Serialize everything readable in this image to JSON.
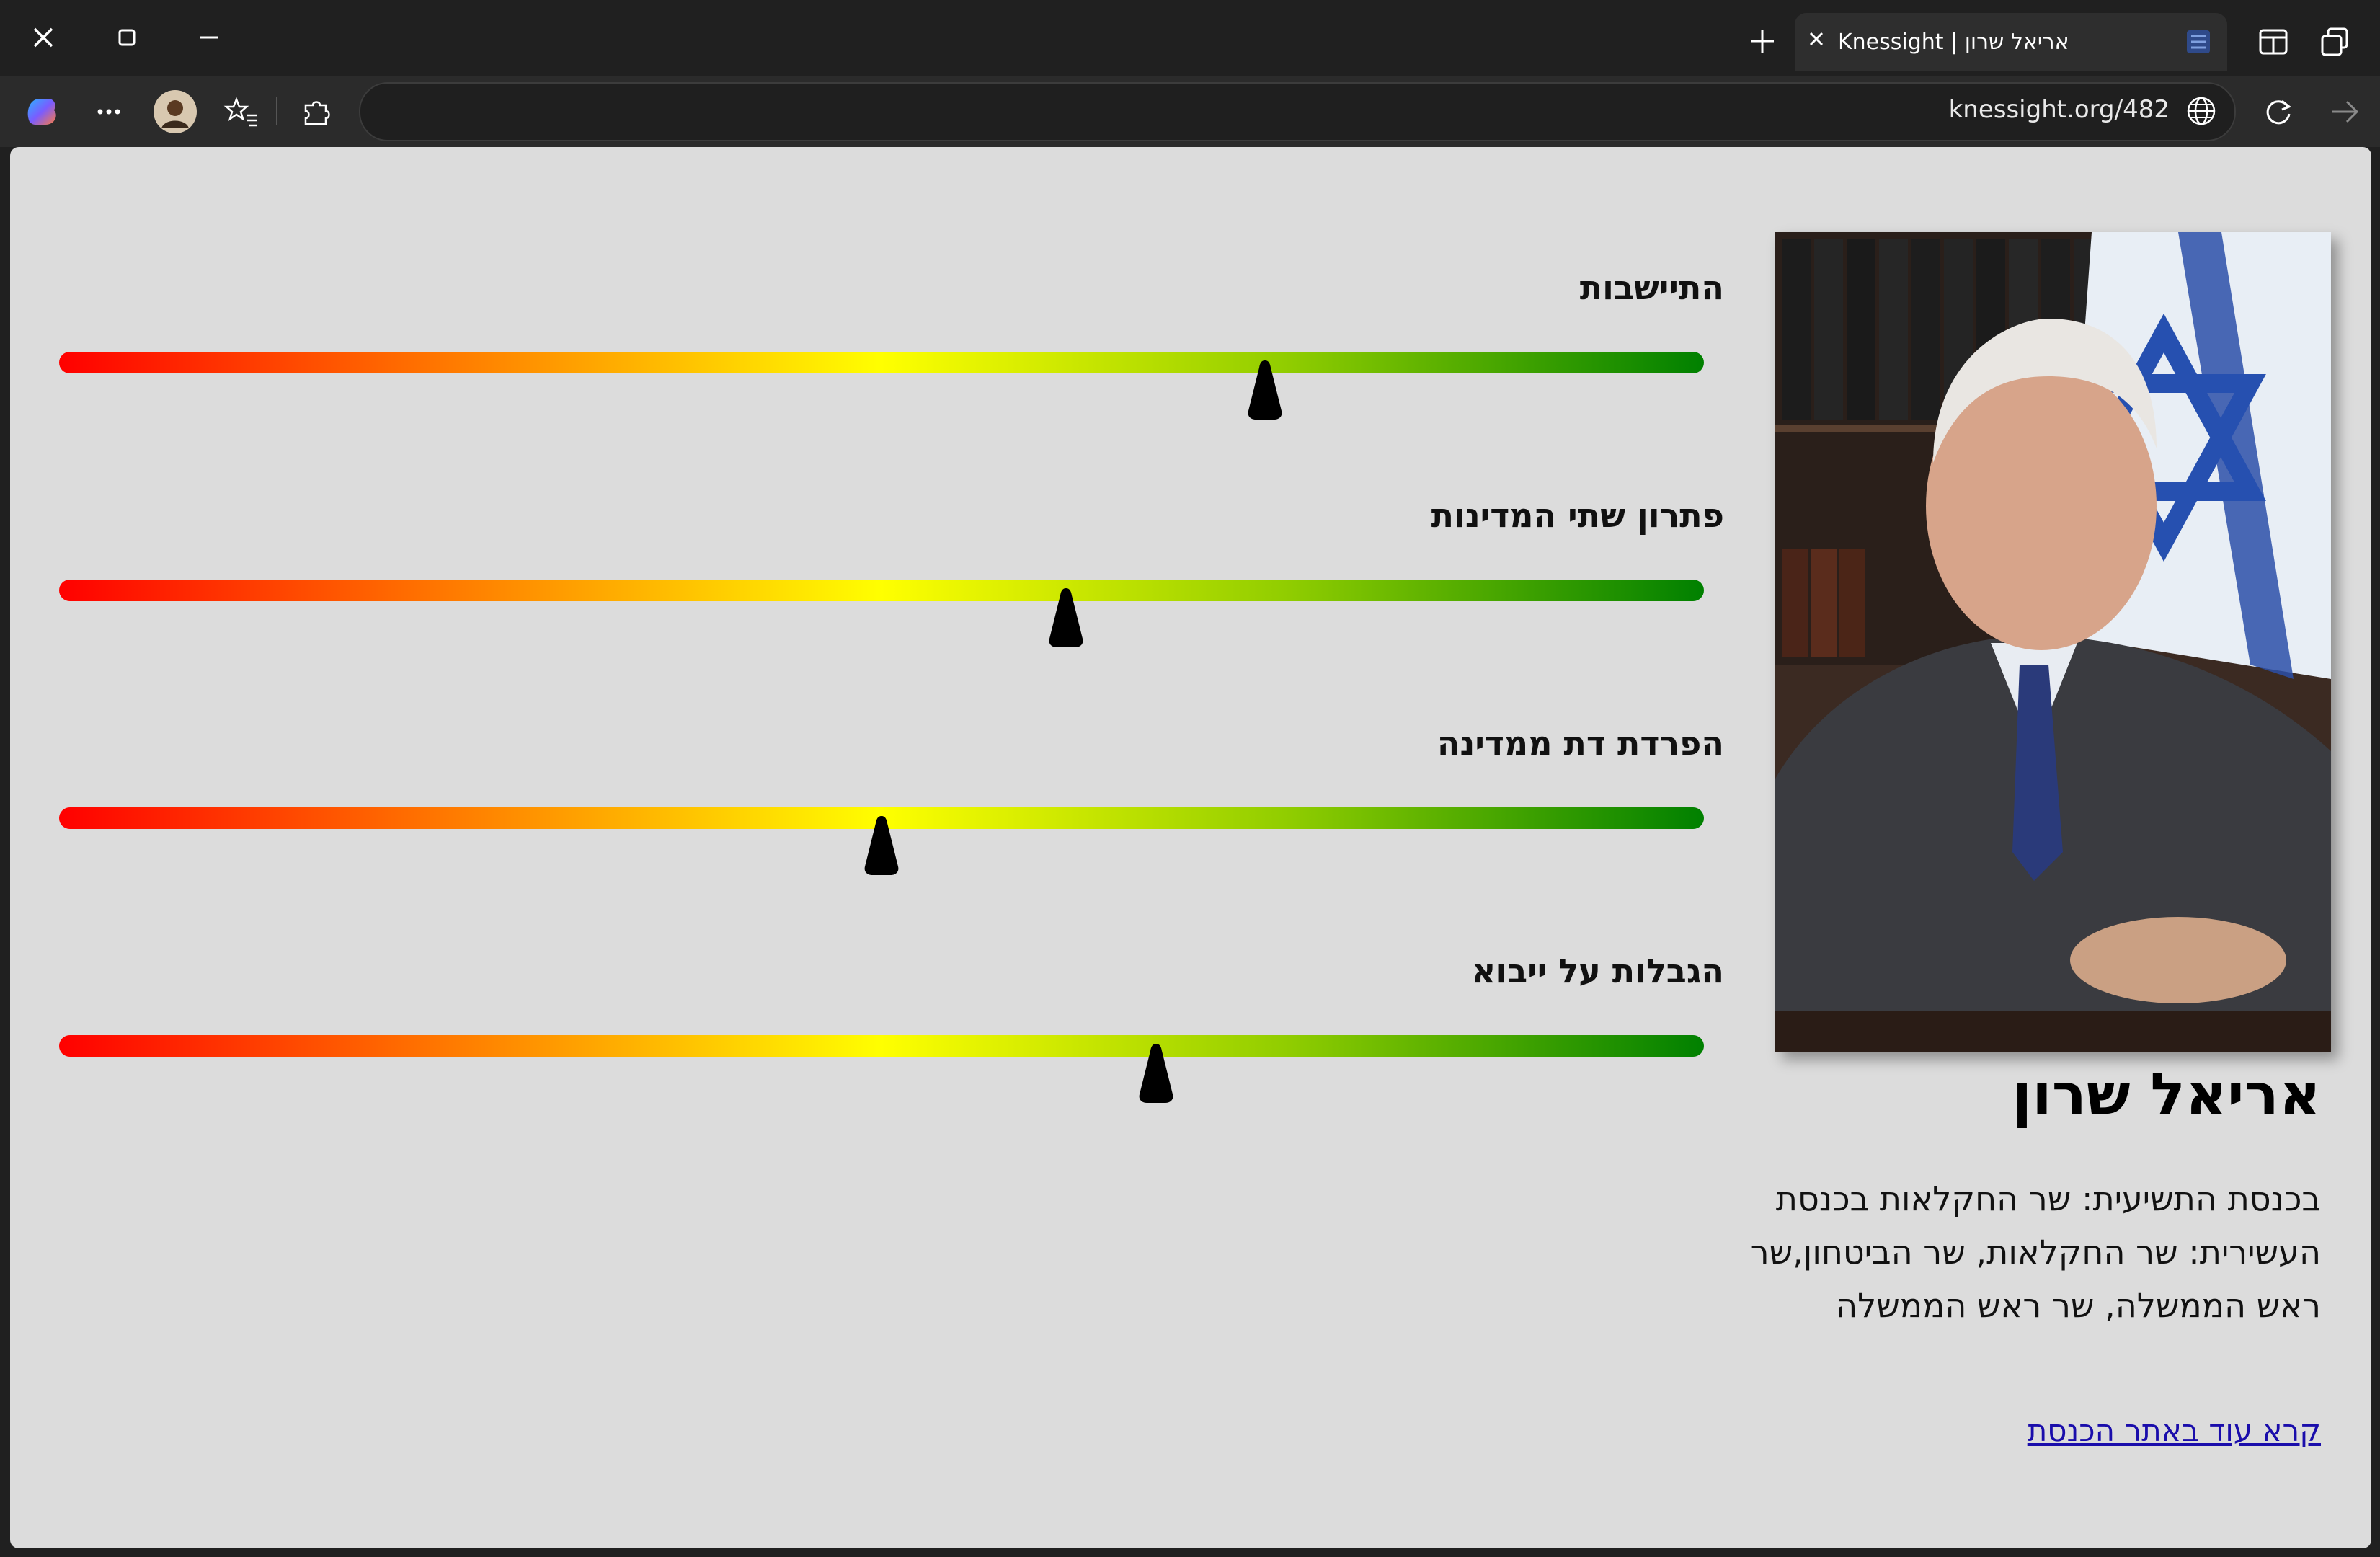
{
  "browser": {
    "tab_title": "Knessight | אריאל שרון",
    "url": "knessight.org/482"
  },
  "politician": {
    "name": "אריאל שרון",
    "roles": "בכנסת התשיעית: שר החקלאות בכנסת העשירית: שר החקלאות, שר הביטחון,שר ראש הממשלה, שר ראש הממשלה",
    "link_text": "קרא עוד באתר הכנסת"
  },
  "sliders": [
    {
      "label": "התיישבות",
      "value": 0.733
    },
    {
      "label": "פתרון שתי המדינות",
      "value": 0.612
    },
    {
      "label": "הפרדת דת ממדינה",
      "value": 0.5
    },
    {
      "label": "הגבלות על ייבוא",
      "value": 0.667
    }
  ],
  "colors": {
    "gradient": [
      "#ff0000",
      "#ff8000",
      "#ffff00",
      "#8fcc00",
      "#008000"
    ],
    "page_background": "#dcdcdc",
    "link": "#1a0dab"
  }
}
